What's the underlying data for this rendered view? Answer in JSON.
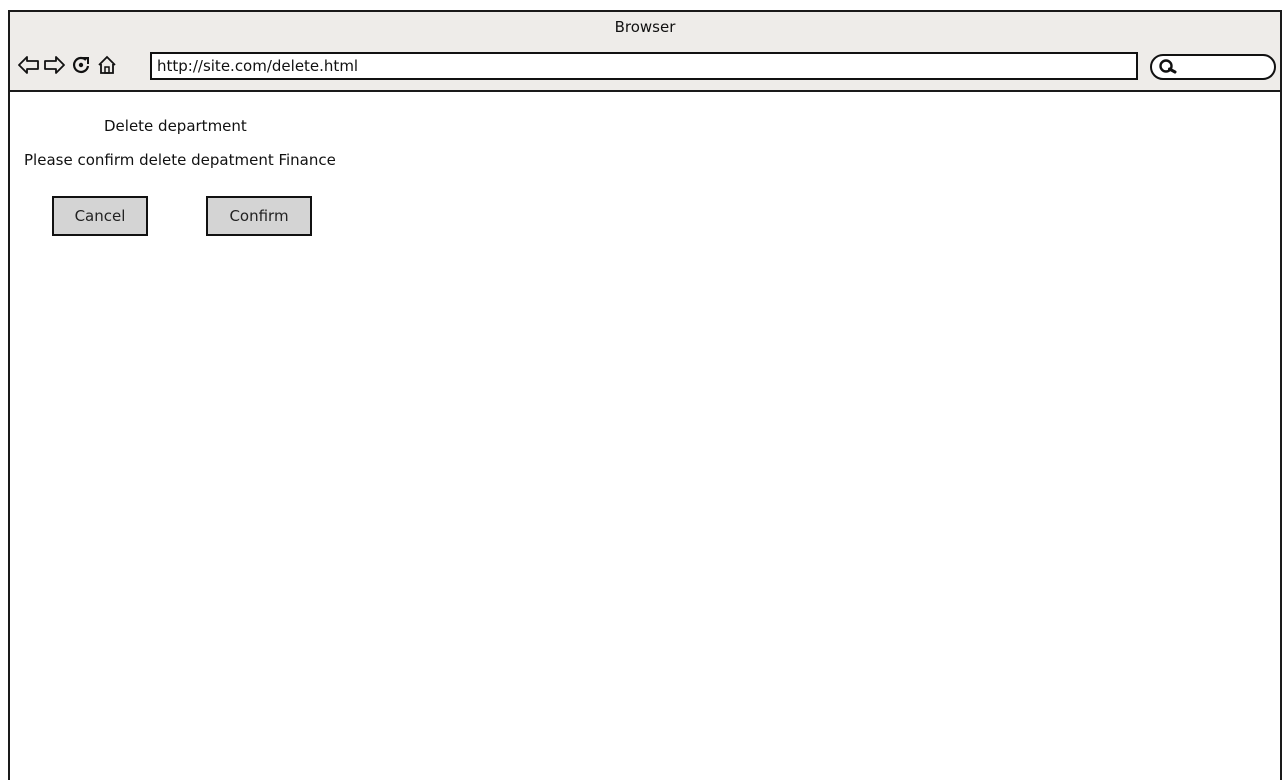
{
  "window": {
    "title": "Browser"
  },
  "toolbar": {
    "back_icon": "back-arrow-icon",
    "forward_icon": "forward-arrow-icon",
    "reload_icon": "reload-icon",
    "home_icon": "home-icon",
    "url": "http://site.com/delete.html",
    "search_icon": "search-icon"
  },
  "page": {
    "heading": "Delete department",
    "message": "Please confirm delete depatment Finance",
    "cancel_label": "Cancel",
    "confirm_label": "Confirm"
  },
  "colors": {
    "chrome_background": "#eeece9",
    "button_background": "#d4d4d4",
    "border": "#111111"
  }
}
